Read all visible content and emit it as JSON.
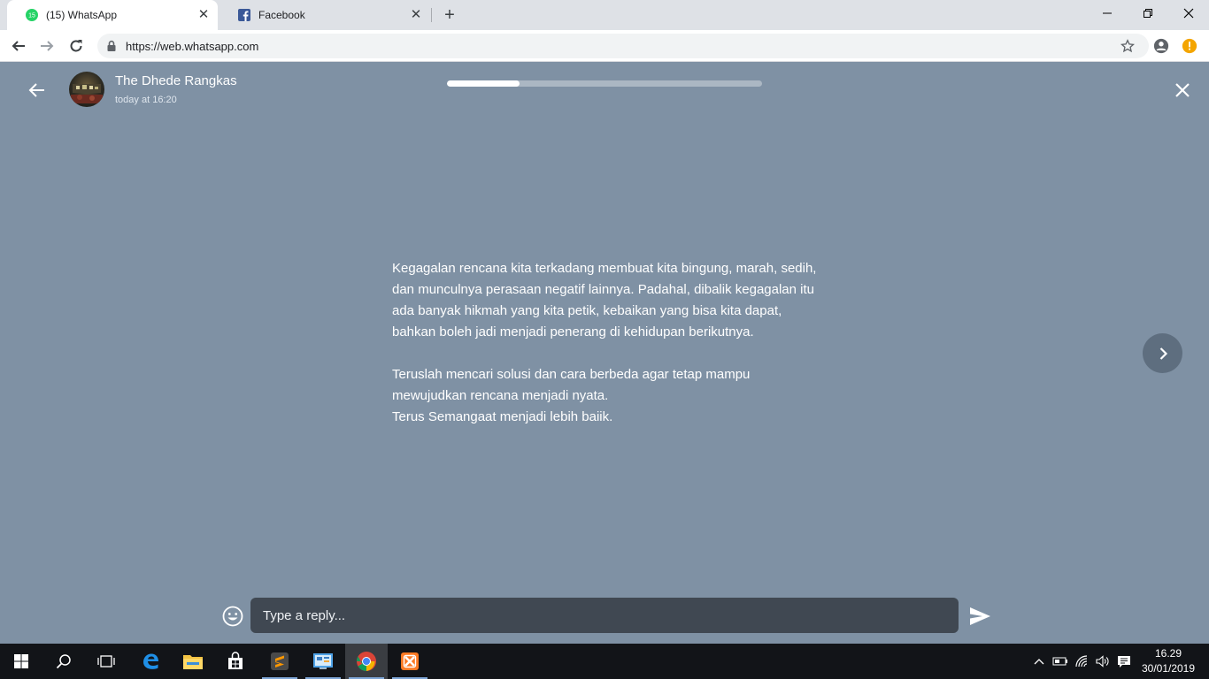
{
  "browser": {
    "tabs": [
      {
        "title": "(15) WhatsApp",
        "badge": "15"
      },
      {
        "title": "Facebook"
      }
    ],
    "url": "https://web.whatsapp.com"
  },
  "status": {
    "contact_name": "The Dhede Rangkas",
    "timestamp": "today at 16:20",
    "progress_fraction": 0.23,
    "paragraphs": [
      "Kegagalan rencana kita terkadang membuat kita bingung, marah, sedih, dan munculnya perasaan negatif lainnya. Padahal, dibalik kegagalan itu ada banyak hikmah yang kita petik, kebaikan yang bisa kita dapat, bahkan boleh jadi menjadi penerang di kehidupan berikutnya.",
      "Teruslah mencari solusi dan cara berbeda agar tetap mampu mewujudkan rencana menjadi nyata.\nTerus Semangaat menjadi lebih baiik."
    ],
    "reply_placeholder": "Type a reply..."
  },
  "taskbar": {
    "time": "16.29",
    "date": "30/01/2019"
  },
  "colors": {
    "viewer_bg": "#7f91a4",
    "whatsapp_green": "#25d366",
    "progress_fill": "#ffffff"
  }
}
